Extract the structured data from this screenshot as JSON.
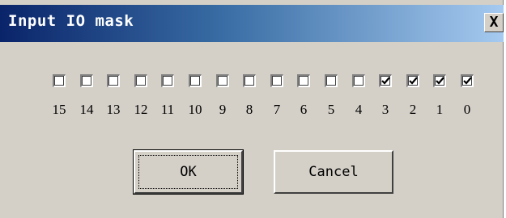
{
  "dialog": {
    "title": "Input IO mask",
    "close_label": "X"
  },
  "bits": [
    {
      "label": "15",
      "checked": false
    },
    {
      "label": "14",
      "checked": false
    },
    {
      "label": "13",
      "checked": false
    },
    {
      "label": "12",
      "checked": false
    },
    {
      "label": "11",
      "checked": false
    },
    {
      "label": "10",
      "checked": false
    },
    {
      "label": "9",
      "checked": false
    },
    {
      "label": "8",
      "checked": false
    },
    {
      "label": "7",
      "checked": false
    },
    {
      "label": "6",
      "checked": false
    },
    {
      "label": "5",
      "checked": false
    },
    {
      "label": "4",
      "checked": false
    },
    {
      "label": "3",
      "checked": true
    },
    {
      "label": "2",
      "checked": true
    },
    {
      "label": "1",
      "checked": true
    },
    {
      "label": "0",
      "checked": true
    }
  ],
  "buttons": {
    "ok_label": "OK",
    "cancel_label": "Cancel"
  },
  "colors": {
    "face": "#d4d0c8",
    "title_start": "#0a246a",
    "title_end": "#a6caf0"
  }
}
